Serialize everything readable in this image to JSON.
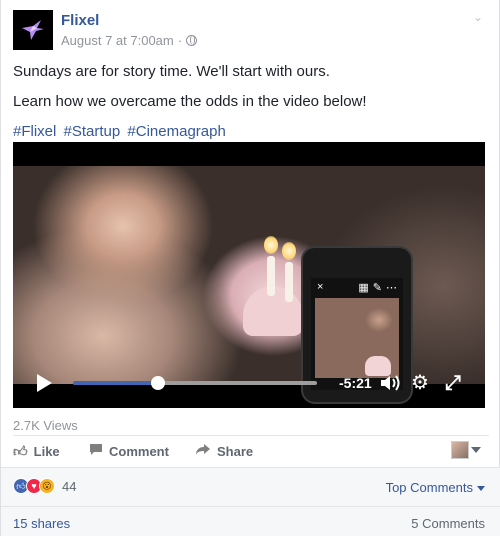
{
  "post": {
    "page_name": "Flixel",
    "timestamp": "August 7 at 7:00am",
    "privacy_icon": "globe-icon",
    "lines": [
      "Sundays are for story time. We'll start with ours.",
      "Learn how we overcame the odds in the video below!"
    ],
    "hashtags": [
      "#Flixel",
      "#Startup",
      "#Cinemagraph"
    ]
  },
  "video": {
    "time_remaining": "-5:21",
    "progress_fraction": 0.35,
    "phone_toolbar": {
      "close": "×",
      "grid": "▦",
      "brush": "✎",
      "more": "⋯"
    }
  },
  "stats": {
    "views": "2.7K Views",
    "reactions_count": "44",
    "top_comments": "Top Comments",
    "shares": "15 shares",
    "comments": "5 Comments"
  },
  "actions": {
    "like": "Like",
    "comment": "Comment",
    "share": "Share"
  },
  "colors": {
    "link": "#365899",
    "accent": "#4267b2"
  }
}
